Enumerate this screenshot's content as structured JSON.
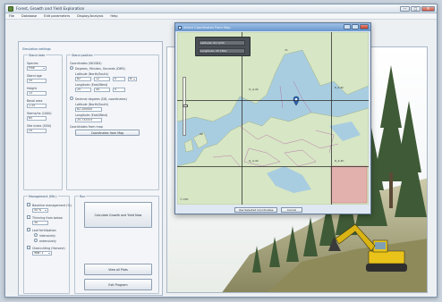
{
  "app": {
    "title": "Forest, Growth and Yield Exploration",
    "menu": [
      "File",
      "Database",
      "Edit parameters",
      "Display/Analysis",
      "Help"
    ],
    "window_buttons": [
      "—",
      "□",
      "X"
    ]
  },
  "left": {
    "group_title": "Simulation settings",
    "stand_data": {
      "title": "Stand data",
      "species_label": "Species",
      "species_value": "Pine",
      "stand_age_label": "Stand age",
      "stand_age_value": "35",
      "height_label": "Height",
      "height_value": "13",
      "basal_area_label": "Basal area",
      "basal_area_value": "1.35",
      "stems_label": "Stems/ha (1000)",
      "stems_value": "65",
      "site_label": "Site index (SI50)",
      "site_value": "24"
    },
    "stand_position": {
      "title": "Stand position",
      "coord_label": "Coordinates (WGS84)",
      "option1": "Degrees, Minutes, Seconds (DMS)",
      "lat_label": "Latitude (North/South)",
      "lat_d": "62",
      "lat_m": "12",
      "lat_s": "0",
      "lat_hemi": "N",
      "lon_label": "Longitude (East/West)",
      "lon_d": "25",
      "lon_m": "44",
      "lon_s": "0",
      "option2": "Decimal degrees (DD, coordinates)",
      "lat2_label": "Latitude (North/South)",
      "lat2_value": "62.200000",
      "lon2_label": "Longitude (East/West)",
      "lon2_value": "25.733333",
      "from_map_label": "Coordinates from map",
      "from_map_button": "Coordinates from Map"
    },
    "management": {
      "title": "Management (Mtr.)",
      "item1": "Baseline management (%)",
      "item1_value": "50 %",
      "item2": "Thinning from below",
      "item2_value": "30",
      "item3": "Leaf fertilization",
      "item3_sub1": "intensively",
      "item3_sub2": "extensively",
      "item4": "Clearcutting (Harvest)",
      "item4_value": "Year: 1"
    },
    "run": {
      "title": "Run",
      "run_button": "Calculate Growth and Yield Now",
      "view_button": "View all Plots",
      "exit_button": "Exit Program"
    }
  },
  "map_dialog": {
    "title": "Select Coordinates From Map",
    "latitude": "Latitude: 62.1234",
    "longitude": "Longitude: 25.7654",
    "cells": [
      "71",
      "O_4-4h",
      "P_4-4h",
      "90",
      "Q_4-4h",
      "R_4-4h"
    ],
    "accept_button": "Use Selected Coordinates",
    "cancel_button": "Cancel",
    "copyright": "© OSM"
  },
  "colors": {
    "map_land": "#d7e6c4",
    "map_water": "#a9cde0",
    "pin": "#2d5fa8",
    "highlight": "#e8a0a6",
    "border": "#b05fa8"
  }
}
